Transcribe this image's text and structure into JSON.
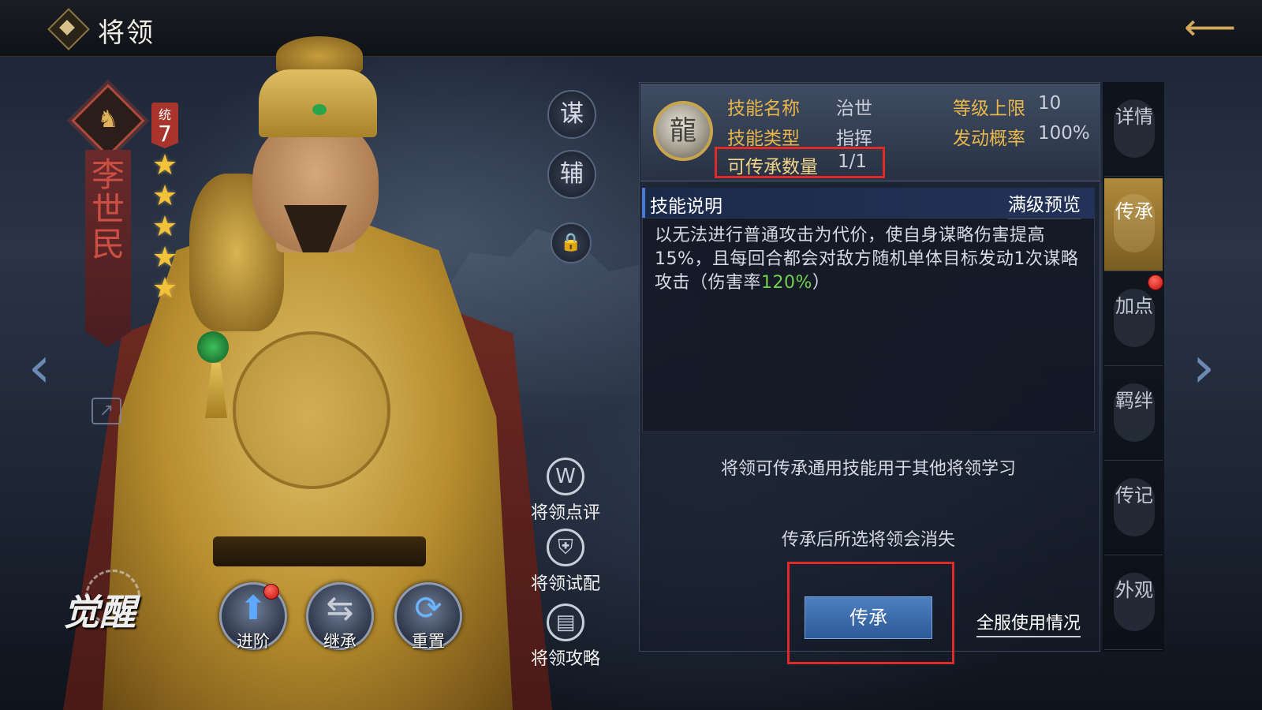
{
  "header": {
    "title": "将领",
    "back": "back-arrow-icon"
  },
  "hero": {
    "name": "李世民",
    "command_label": "统",
    "command_value": "7",
    "stars": 5,
    "awaken_label": "觉醒"
  },
  "skill_mode_buttons": {
    "mou": "谋",
    "fu": "辅"
  },
  "actions": [
    {
      "label": "进阶",
      "icon": "up-arrow-icon",
      "badge": true
    },
    {
      "label": "继承",
      "icon": "swap-arrows-icon",
      "badge": false
    },
    {
      "label": "重置",
      "icon": "refresh-icon",
      "badge": false
    }
  ],
  "tools": {
    "review": "将领点评",
    "trial": "将领试配",
    "guide": "将领攻略"
  },
  "skill": {
    "name_label": "技能名称",
    "name_value": "治世",
    "type_label": "技能类型",
    "type_value": "指挥",
    "level_cap_label": "等级上限",
    "level_cap_value": "10",
    "trigger_label": "发动概率",
    "trigger_value": "100%",
    "inherit_count_label": "可传承数量",
    "inherit_count_value": "1/1"
  },
  "description": {
    "title": "技能说明",
    "preview_link": "满级预览",
    "text_main": "以无法进行普通攻击为代价，使自身谋略伤害提高15%，且每回合都会对敌方随机单体目标发动1次谋略攻击（伤害率",
    "text_highlight": "120%",
    "text_end": "）"
  },
  "notes": {
    "line1": "将领可传承通用技能用于其他将领学习",
    "line2": "传承后所选将领会消失"
  },
  "inherit_button": "传承",
  "usage_link": "全服使用情况",
  "tabs": [
    {
      "label": "详情",
      "active": false
    },
    {
      "label": "传承",
      "active": true
    },
    {
      "label": "加点",
      "active": false,
      "badge": true
    },
    {
      "label": "羁绊",
      "active": false
    },
    {
      "label": "传记",
      "active": false
    },
    {
      "label": "外观",
      "active": false
    }
  ],
  "colors": {
    "gold": "#e9b64a",
    "highlight_red": "#e02a2a",
    "green": "#6fd24a",
    "button_blue": "#3a6cae"
  }
}
